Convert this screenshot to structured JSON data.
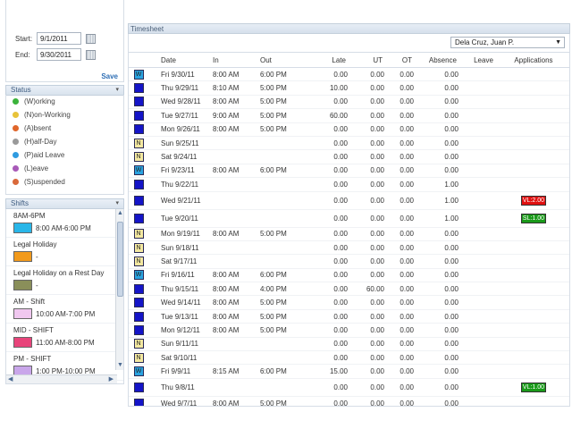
{
  "filters": {
    "start_label": "Start:",
    "start_value": "9/1/2011",
    "end_label": "End:",
    "end_value": "9/30/2011",
    "save_label": "Save"
  },
  "status_panel": {
    "title": "Status",
    "items": [
      {
        "label": "(W)orking",
        "color": "#3bb33b"
      },
      {
        "label": "(N)on-Working",
        "color": "#e8c33a"
      },
      {
        "label": "(A)bsent",
        "color": "#e0662b"
      },
      {
        "label": "(H)alf-Day",
        "color": "#9a9a9a"
      },
      {
        "label": "(P)aid Leave",
        "color": "#2f9be0"
      },
      {
        "label": "(L)eave",
        "color": "#a85ab8"
      },
      {
        "label": "(S)uspended",
        "color": "#d9693a"
      }
    ]
  },
  "shifts_panel": {
    "title": "Shifts",
    "items": [
      {
        "name": "8AM-6PM",
        "time": "8:00 AM-6:00 PM",
        "color": "#29b6e8"
      },
      {
        "name": "Legal Holiday",
        "time": "-",
        "color": "#f29a1c"
      },
      {
        "name": "Legal Holiday on a Rest Day",
        "time": "-",
        "color": "#8a8f5a"
      },
      {
        "name": "AM - Shift",
        "time": "10:00 AM-7:00 PM",
        "color": "#f0c7ef"
      },
      {
        "name": "MID - SHIFT",
        "time": "11:00 AM-8:00 PM",
        "color": "#e8447a"
      },
      {
        "name": "PM - SHIFT",
        "time": "1:00 PM-10:00 PM",
        "color": "#c9a6ea"
      }
    ]
  },
  "timesheet": {
    "title": "Timesheet",
    "employee": "Dela Cruz, Juan P.",
    "columns": {
      "date": "Date",
      "in": "In",
      "out": "Out",
      "late": "Late",
      "ut": "UT",
      "ot": "OT",
      "absence": "Absence",
      "leave": "Leave",
      "applications": "Applications"
    },
    "rows": [
      {
        "code": "W",
        "date": "Fri 9/30/11",
        "in": "8:00 AM",
        "out": "6:00 PM",
        "late": "0.00",
        "ut": "0.00",
        "ot": "0.00",
        "absence": "0.00",
        "app": ""
      },
      {
        "code": "",
        "date": "Thu 9/29/11",
        "in": "8:10 AM",
        "out": "5:00 PM",
        "late": "10.00",
        "ut": "0.00",
        "ot": "0.00",
        "absence": "0.00",
        "app": ""
      },
      {
        "code": "",
        "date": "Wed 9/28/11",
        "in": "8:00 AM",
        "out": "5:00 PM",
        "late": "0.00",
        "ut": "0.00",
        "ot": "0.00",
        "absence": "0.00",
        "app": ""
      },
      {
        "code": "",
        "date": "Tue 9/27/11",
        "in": "9:00 AM",
        "out": "5:00 PM",
        "late": "60.00",
        "ut": "0.00",
        "ot": "0.00",
        "absence": "0.00",
        "app": ""
      },
      {
        "code": "",
        "date": "Mon 9/26/11",
        "in": "8:00 AM",
        "out": "5:00 PM",
        "late": "0.00",
        "ut": "0.00",
        "ot": "0.00",
        "absence": "0.00",
        "app": ""
      },
      {
        "code": "N",
        "date": "Sun 9/25/11",
        "in": "",
        "out": "",
        "late": "0.00",
        "ut": "0.00",
        "ot": "0.00",
        "absence": "0.00",
        "app": ""
      },
      {
        "code": "N",
        "date": "Sat 9/24/11",
        "in": "",
        "out": "",
        "late": "0.00",
        "ut": "0.00",
        "ot": "0.00",
        "absence": "0.00",
        "app": ""
      },
      {
        "code": "W",
        "date": "Fri 9/23/11",
        "in": "8:00 AM",
        "out": "6:00 PM",
        "late": "0.00",
        "ut": "0.00",
        "ot": "0.00",
        "absence": "0.00",
        "app": ""
      },
      {
        "code": "",
        "date": "Thu 9/22/11",
        "in": "",
        "out": "",
        "late": "0.00",
        "ut": "0.00",
        "ot": "0.00",
        "absence": "1.00",
        "app": ""
      },
      {
        "code": "",
        "date": "Wed 9/21/11",
        "in": "",
        "out": "",
        "late": "0.00",
        "ut": "0.00",
        "ot": "0.00",
        "absence": "1.00",
        "app": "VL:2.00",
        "app_color": "#e01010"
      },
      {
        "code": "",
        "date": "Tue 9/20/11",
        "in": "",
        "out": "",
        "late": "0.00",
        "ut": "0.00",
        "ot": "0.00",
        "absence": "1.00",
        "app": "SL:1.00",
        "app_color": "#1a9a1a"
      },
      {
        "code": "N",
        "date": "Mon 9/19/11",
        "in": "8:00 AM",
        "out": "5:00 PM",
        "late": "0.00",
        "ut": "0.00",
        "ot": "0.00",
        "absence": "0.00",
        "app": ""
      },
      {
        "code": "N",
        "date": "Sun 9/18/11",
        "in": "",
        "out": "",
        "late": "0.00",
        "ut": "0.00",
        "ot": "0.00",
        "absence": "0.00",
        "app": ""
      },
      {
        "code": "N",
        "date": "Sat 9/17/11",
        "in": "",
        "out": "",
        "late": "0.00",
        "ut": "0.00",
        "ot": "0.00",
        "absence": "0.00",
        "app": ""
      },
      {
        "code": "W",
        "date": "Fri 9/16/11",
        "in": "8:00 AM",
        "out": "6:00 PM",
        "late": "0.00",
        "ut": "0.00",
        "ot": "0.00",
        "absence": "0.00",
        "app": ""
      },
      {
        "code": "",
        "date": "Thu 9/15/11",
        "in": "8:00 AM",
        "out": "4:00 PM",
        "late": "0.00",
        "ut": "60.00",
        "ot": "0.00",
        "absence": "0.00",
        "app": ""
      },
      {
        "code": "",
        "date": "Wed 9/14/11",
        "in": "8:00 AM",
        "out": "5:00 PM",
        "late": "0.00",
        "ut": "0.00",
        "ot": "0.00",
        "absence": "0.00",
        "app": ""
      },
      {
        "code": "",
        "date": "Tue 9/13/11",
        "in": "8:00 AM",
        "out": "5:00 PM",
        "late": "0.00",
        "ut": "0.00",
        "ot": "0.00",
        "absence": "0.00",
        "app": ""
      },
      {
        "code": "",
        "date": "Mon 9/12/11",
        "in": "8:00 AM",
        "out": "5:00 PM",
        "late": "0.00",
        "ut": "0.00",
        "ot": "0.00",
        "absence": "0.00",
        "app": ""
      },
      {
        "code": "N",
        "date": "Sun 9/11/11",
        "in": "",
        "out": "",
        "late": "0.00",
        "ut": "0.00",
        "ot": "0.00",
        "absence": "0.00",
        "app": ""
      },
      {
        "code": "N",
        "date": "Sat 9/10/11",
        "in": "",
        "out": "",
        "late": "0.00",
        "ut": "0.00",
        "ot": "0.00",
        "absence": "0.00",
        "app": ""
      },
      {
        "code": "W",
        "date": "Fri 9/9/11",
        "in": "8:15 AM",
        "out": "6:00 PM",
        "late": "15.00",
        "ut": "0.00",
        "ot": "0.00",
        "absence": "0.00",
        "app": ""
      },
      {
        "code": "",
        "date": "Thu 9/8/11",
        "in": "",
        "out": "",
        "late": "0.00",
        "ut": "0.00",
        "ot": "0.00",
        "absence": "0.00",
        "app": "VL:1.00",
        "app_color": "#1a9a1a"
      },
      {
        "code": "",
        "date": "Wed 9/7/11",
        "in": "8:00 AM",
        "out": "5:00 PM",
        "late": "0.00",
        "ut": "0.00",
        "ot": "0.00",
        "absence": "0.00",
        "app": ""
      }
    ],
    "code_colors": {
      "W": "#2aa3e0",
      "N": "#f3e8a0",
      "": "#1414c8"
    }
  }
}
